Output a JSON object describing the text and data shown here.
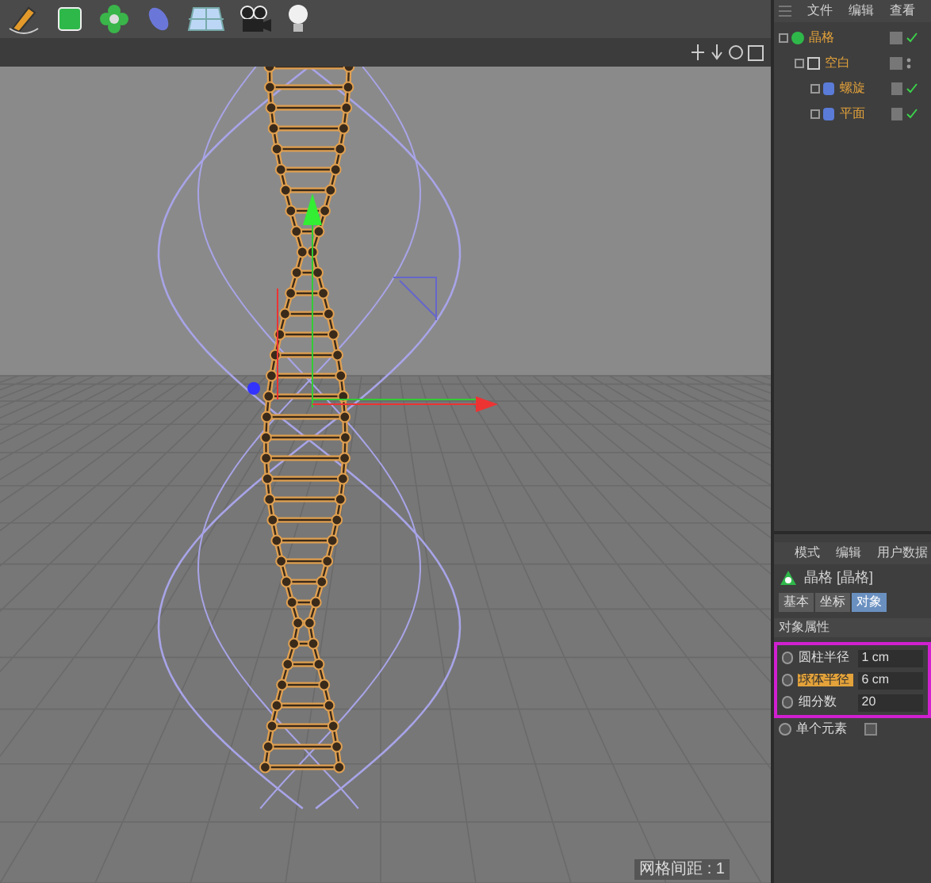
{
  "object_manager": {
    "menu": [
      "文件",
      "编辑",
      "查看"
    ],
    "tree": [
      {
        "name": "晶格",
        "visible": true,
        "children": [
          {
            "name": "空白",
            "visible": false,
            "children": [
              {
                "name": "螺旋",
                "visible": true
              },
              {
                "name": "平面",
                "visible": true
              }
            ]
          }
        ]
      }
    ]
  },
  "attributes": {
    "menu": [
      "模式",
      "编辑",
      "用户数据"
    ],
    "title": "晶格 [晶格]",
    "tabs": [
      {
        "label": "基本",
        "selected": false
      },
      {
        "label": "坐标",
        "selected": false
      },
      {
        "label": "对象",
        "selected": true
      }
    ],
    "section": "对象属性",
    "fields": [
      {
        "kind": "number",
        "label": "圆柱半径",
        "value": "1 cm",
        "boxed": true,
        "active": false
      },
      {
        "kind": "number",
        "label": "球体半径",
        "value": "6 cm",
        "boxed": true,
        "active": true
      },
      {
        "kind": "number",
        "label": "细分数",
        "value": "20",
        "boxed": true,
        "active": false
      },
      {
        "kind": "checkbox",
        "label": "单个元素",
        "checked": false,
        "boxed": false,
        "active": false
      }
    ]
  },
  "viewport": {
    "status": "网格间距 : 1"
  }
}
